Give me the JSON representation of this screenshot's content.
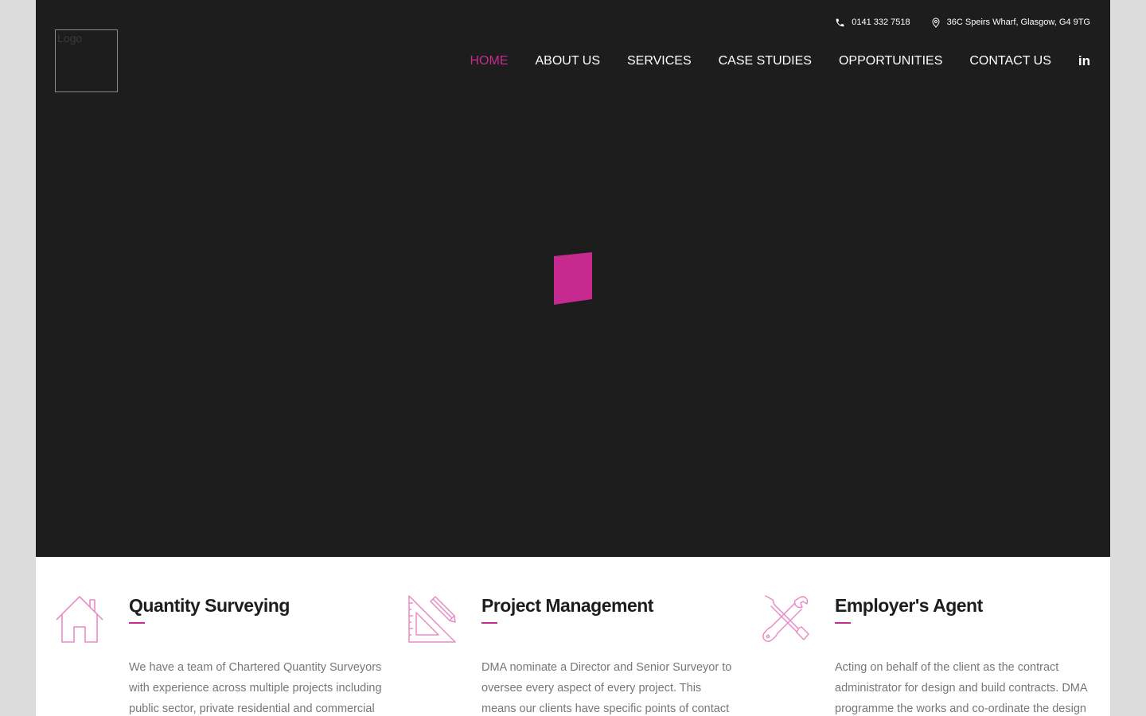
{
  "logo": {
    "text": "Logo"
  },
  "topbar": {
    "phone": "0141 332 7518",
    "address": "36C Speirs Wharf, Glasgow, G4 9TG"
  },
  "nav": {
    "items": [
      {
        "label": "HOME",
        "active": true
      },
      {
        "label": "ABOUT US"
      },
      {
        "label": "SERVICES"
      },
      {
        "label": "CASE STUDIES"
      },
      {
        "label": "OPPORTUNITIES"
      },
      {
        "label": "CONTACT US"
      }
    ],
    "social": {
      "label": "in",
      "icon": "linkedin-icon"
    }
  },
  "colors": {
    "accent": "#c72a8f",
    "icon_pink": "#e88cc6",
    "hero_bg": "#1d1d1d",
    "body_text": "#777777",
    "heading": "#1d1d1d"
  },
  "features": [
    {
      "icon": "house-icon",
      "title": "Quantity Surveying",
      "text": "We have a team of Chartered Quantity Surveyors with experience across multiple projects including public sector, private residential and commercial"
    },
    {
      "icon": "set-square-pencil-icon",
      "title": "Project Management",
      "text": "DMA nominate a Director and Senior Surveyor to oversee every aspect of every project. This means our clients have specific points of contact from"
    },
    {
      "icon": "wrench-screwdriver-icon",
      "title": "Employer's Agent",
      "text": "Acting on behalf of the client as the contract administrator for design and build contracts. DMA programme the works and co-ordinate the design"
    }
  ]
}
